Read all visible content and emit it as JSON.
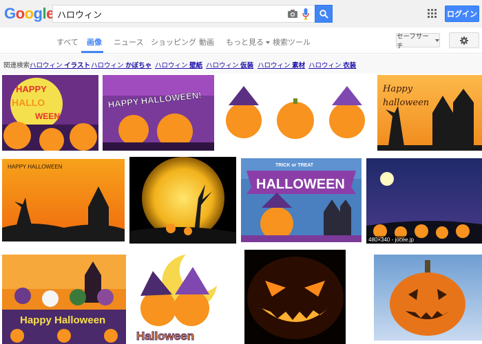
{
  "header": {
    "logo": [
      "G",
      "o",
      "o",
      "g",
      "l",
      "e"
    ],
    "logo_colors": [
      "#4285f4",
      "#ea4335",
      "#fbbc05",
      "#4285f4",
      "#34a853",
      "#ea4335"
    ],
    "search_value": "ハロウィン",
    "login_label": "ログイン"
  },
  "tabs": {
    "items": [
      "すべて",
      "画像",
      "ニュース",
      "ショッピング",
      "動画",
      "もっと見る",
      "検索ツール"
    ],
    "active_index": 1,
    "safesearch_label": "セーフサーチ"
  },
  "related": {
    "label": "関連検索:",
    "links": [
      {
        "base": "ハロウィン",
        "term": "イラスト"
      },
      {
        "base": "ハロウィン",
        "term": "かぼちゃ"
      },
      {
        "base": "ハロウィン",
        "term": "壁紙"
      },
      {
        "base": "ハロウィン",
        "term": "仮装"
      },
      {
        "base": "ハロウィン",
        "term": "素材"
      },
      {
        "base": "ハロウィン",
        "term": "衣装"
      }
    ]
  },
  "images": {
    "img1_text": [
      "HAPPY",
      "HALLO",
      "WEEN"
    ],
    "img2_text": "HAPPY HALLOWEEN!",
    "img4_text": [
      "Happy",
      "halloween"
    ],
    "img5_text": "HAPPY HALLOWEEN",
    "img7_banner_top": "TRICK or TREAT",
    "img7_banner": "HALLOWEEN",
    "img8_caption": "480×340 - jocee.jp",
    "img9_text": "Happy Halloween",
    "img10_text": "Halloween"
  },
  "colors": {
    "accent": "#4285f4",
    "link": "#1a0dab",
    "pumpkin": "#f7931e",
    "night_purple": "#4b2a6e"
  }
}
